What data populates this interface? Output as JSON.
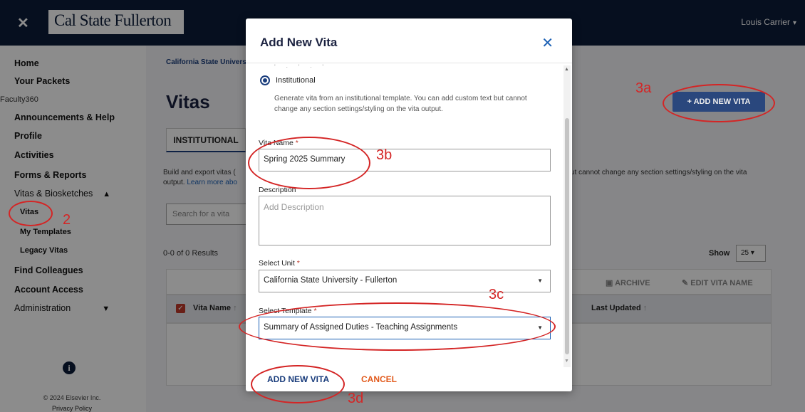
{
  "topbar": {
    "brand": "Cal State Fullerton",
    "user": "Louis Carrier"
  },
  "sidebar": {
    "home": "Home",
    "packets": "Your Packets",
    "section": "Faculty360",
    "announcements": "Announcements & Help",
    "profile": "Profile",
    "activities": "Activities",
    "forms": "Forms & Reports",
    "vitas_group": "Vitas & Biosketches",
    "vitas": "Vitas",
    "templates": "My Templates",
    "legacy": "Legacy Vitas",
    "colleagues": "Find Colleagues",
    "access": "Account Access",
    "admin": "Administration",
    "copyright": "© 2024 Elsevier Inc.",
    "privacy": "Privacy Policy"
  },
  "main": {
    "crumb": "California State Univers",
    "title": "Vitas",
    "tab": "INSTITUTIONAL",
    "desc1": "Build and export vitas (",
    "desc2": "output.",
    "learn": "Learn more abo",
    "desc_right": "ut cannot change any section settings/styling on the vita",
    "search_placeholder": "Search for a vita",
    "results": "0-0 of 0 Results",
    "show": "Show",
    "show_value": "25",
    "archive": "ARCHIVE",
    "edit_name": "EDIT VITA NAME",
    "col_name": "Vita Name",
    "col_updated": "Last Updated",
    "add_new": "ADD NEW VITA"
  },
  "modal": {
    "title": "Add New Vita",
    "radio_label": "Institutional",
    "radio_desc": "Generate vita from an institutional template. You can add custom text but cannot change any section settings/styling on the vita output.",
    "name_label": "Vita Name",
    "name_value": "Spring 2025 Summary",
    "desc_label": "Description",
    "desc_placeholder": "Add Description",
    "unit_label": "Select Unit",
    "unit_value": "California State University - Fullerton",
    "template_label": "Select Template",
    "template_value": "Summary of Assigned Duties - Teaching Assignments",
    "add_button": "ADD NEW VITA",
    "cancel_button": "CANCEL"
  },
  "annotations": {
    "a": "2",
    "b": "3a",
    "c": "3b",
    "d": "3c",
    "e": "3d"
  },
  "colors": {
    "navy": "#0b1c3a",
    "accent": "#1a3d7c",
    "annot": "#d42525",
    "cancel": "#e25b1d"
  }
}
